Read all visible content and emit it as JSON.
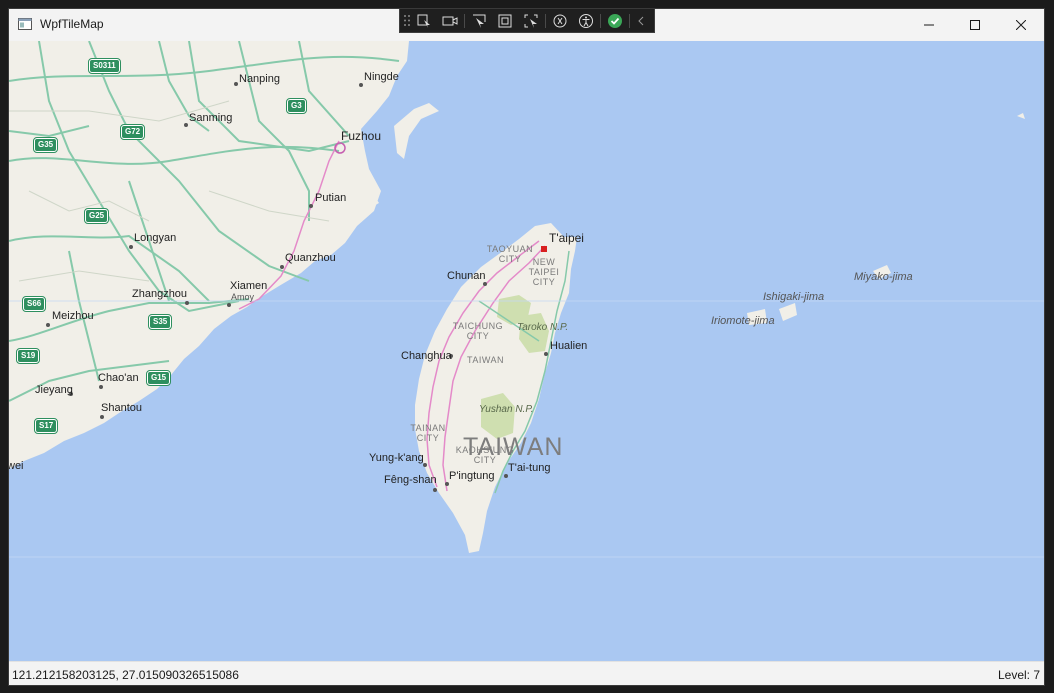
{
  "window": {
    "title": "WpfTileMap",
    "icon": "app-window-icon",
    "controls": [
      "minimize-icon",
      "maximize-icon",
      "close-icon"
    ]
  },
  "debug_toolbar": {
    "buttons": [
      "select-element-icon",
      "live-preview-icon",
      "select-icon",
      "display-layout-adorners-icon",
      "track-focus-icon",
      "binding-failures-icon",
      "accessibility-icon",
      "check-circle-icon",
      "collapse-chevron-icon"
    ]
  },
  "map": {
    "labels": {
      "nanping": "Nanping",
      "ningde": "Ningde",
      "sanming": "Sanming",
      "fuzhou": "Fuzhou",
      "putian": "Putian",
      "longyan": "Longyan",
      "quanzhou": "Quanzhou",
      "xiamen": "Xiamen",
      "amoy": "Amoy",
      "zhangzhou": "Zhangzhou",
      "meizhou": "Meizhou",
      "chaoan": "Chao'an",
      "jieyang": "Jieyang",
      "shantou": "Shantou",
      "wei": "wei",
      "taipei": "T'aipei",
      "taoyuan": "TAOYUAN CITY",
      "newtaipei": "NEW TAIPEI CITY",
      "chunan": "Chunan",
      "taichung": "TAICHUNG CITY",
      "taroko": "Taroko N.P.",
      "hualien": "Hualien",
      "changhua": "Changhua",
      "taiwan_small": "TAIWAN",
      "yushan": "Yushan N.P.",
      "tainan": "TAINAN CITY",
      "kaohsiung": "KAOHSIUNG CITY",
      "country": "TAIWAN",
      "yungkang": "Yung-k'ang",
      "taitung": "T'ai-tung",
      "pingtung": "P'ingtung",
      "fengshan": "Fêng-shan",
      "miyako": "Miyako-jima",
      "ishigaki": "Ishigaki-jima",
      "iriomote": "Iriomote-jima"
    },
    "shields": {
      "s0311": "S0311",
      "g3": "G3",
      "g35": "G35",
      "g72": "G72",
      "g25": "G25",
      "s66": "S66",
      "s35": "S35",
      "s19": "S19",
      "g15": "G15",
      "s17": "S17"
    },
    "colors": {
      "water": "#aac8f2",
      "land": "#f1efe8",
      "park": "#cfdfb0",
      "highway": "#86c9aa",
      "major_road": "#e48ac9",
      "shield": "#2e8f5f"
    }
  },
  "status": {
    "coordinates": "121.212158203125, 27.015090326515086",
    "level": "Level: 7"
  }
}
